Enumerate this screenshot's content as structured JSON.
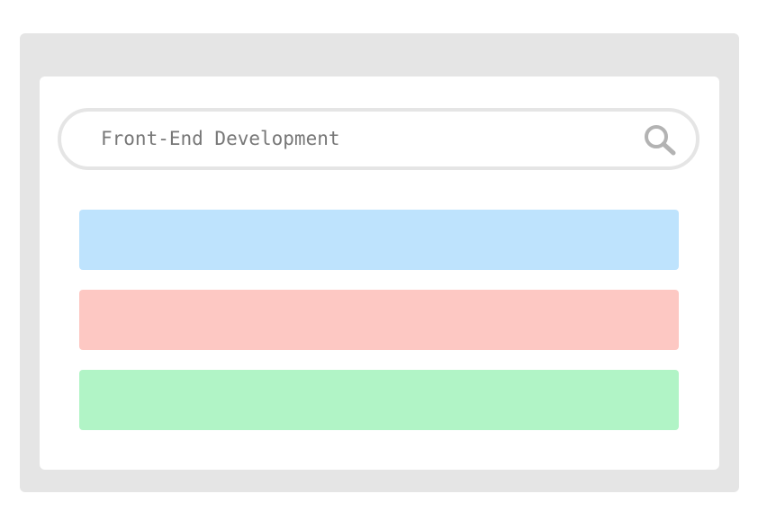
{
  "search": {
    "query": "Front-End Development",
    "icon": "magnifier"
  },
  "results": [
    {
      "color": "#bee3fd"
    },
    {
      "color": "#fdc8c3"
    },
    {
      "color": "#b1f4c6"
    }
  ],
  "colors": {
    "frame": "#e5e5e5",
    "panel": "#ffffff",
    "text": "#777777",
    "icon": "#b3b3b3"
  }
}
